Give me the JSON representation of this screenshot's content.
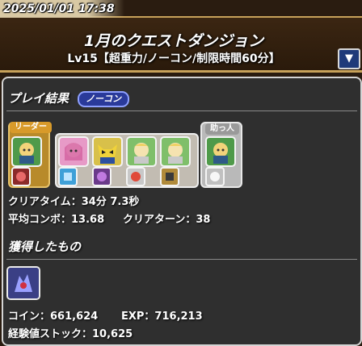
{
  "timestamp": "2025/01/01 17:38",
  "dungeon": {
    "title": "1月のクエストダンジョン",
    "subtitle": "Lv15【超重力/ノーコン/制限時間60分】",
    "collapse_icon": "▼"
  },
  "result": {
    "title": "プレイ結果",
    "badge": "ノーコン",
    "leader_label": "リーダー",
    "helper_label": "助っ人",
    "clear_time": "クリアタイム：34分 7.3秒",
    "avg_combo": "平均コンボ：13.68",
    "clear_turns": "クリアターン：38"
  },
  "team": {
    "leader": {
      "icon": "golden-hair-warrior-icon",
      "color": "#4f9a4a",
      "attr": "#8b2a2a"
    },
    "subs": [
      {
        "icon": "pink-hair-girl-icon",
        "color": "#e79ac7",
        "attr": "#3fa0d8"
      },
      {
        "icon": "yellow-mask-hero-icon",
        "color": "#d8c04a",
        "attr": "#6a3a8a"
      },
      {
        "icon": "blonde-knight-icon",
        "color": "#7fbf6a",
        "attr": "#c8c8c8"
      },
      {
        "icon": "blonde-knight-icon",
        "color": "#7fbf6a",
        "attr": "#b08a3a"
      }
    ],
    "helper": {
      "icon": "golden-hair-warrior-icon",
      "color": "#4f9a4a",
      "attr": "#c0c0c0"
    }
  },
  "rewards": {
    "title": "獲得したもの",
    "item_icon": "dark-dragon-card-icon",
    "coins": "コイン：661,624",
    "exp": "EXP：716,213",
    "exp_stock": "経験値ストック：10,625"
  },
  "colors": {
    "banner_border": "#c8a25a",
    "leader_frame": "#b88a2a",
    "panel_bg": "#2f2f2f",
    "badge_bg": "#2a3a9a"
  }
}
